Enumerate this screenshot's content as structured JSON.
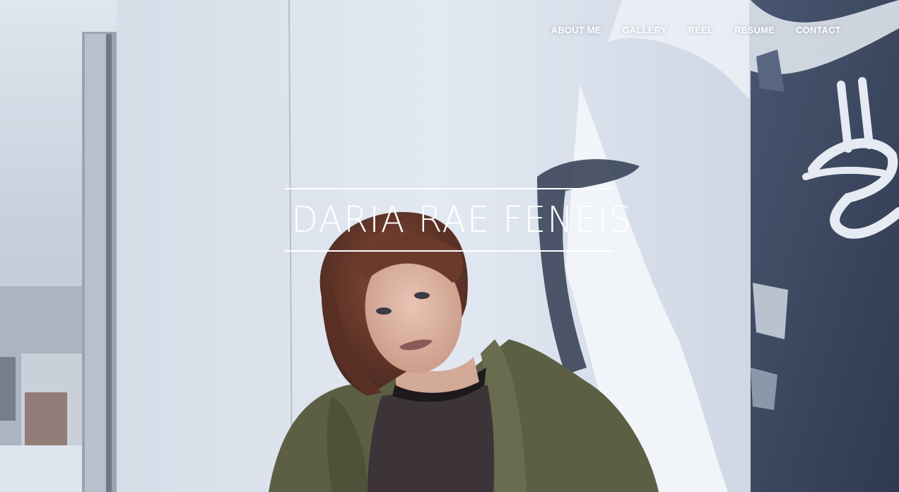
{
  "nav": {
    "items": [
      {
        "label": "ABOUT ME"
      },
      {
        "label": "GALLERY"
      },
      {
        "label": "REEL"
      },
      {
        "label": "RESUME"
      },
      {
        "label": "CONTACT"
      }
    ]
  },
  "hero": {
    "title": "DARIA RAE FENEIS"
  },
  "colors": {
    "text": "#ffffff",
    "wall": "#dde4ef",
    "graffiti": "#3e4a60",
    "sky": "#c9d2df"
  }
}
